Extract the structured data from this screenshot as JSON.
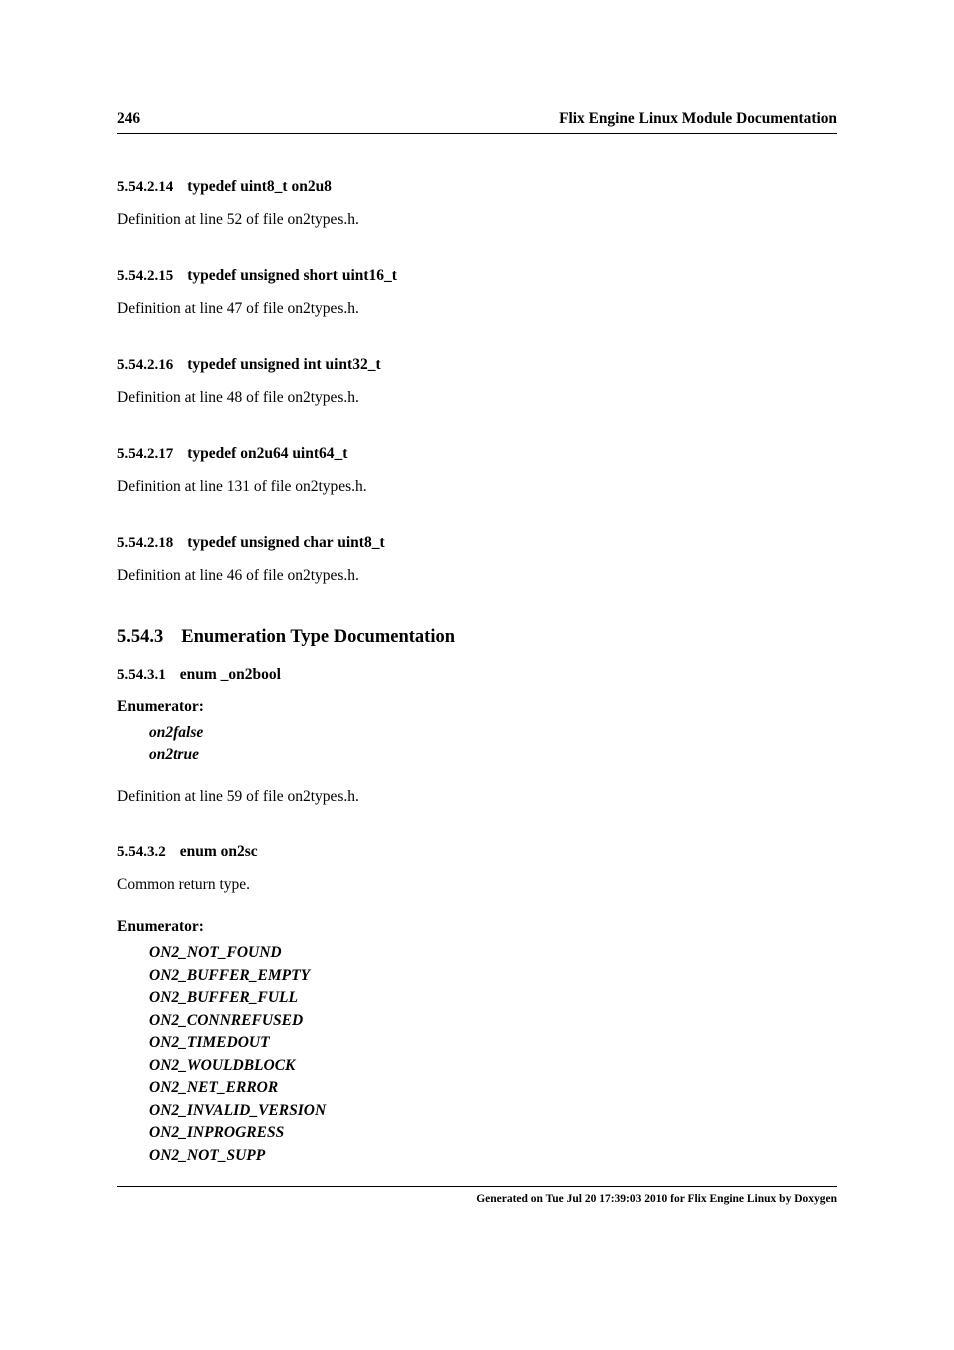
{
  "header": {
    "page_number": "246",
    "title": "Flix Engine Linux Module Documentation"
  },
  "sections": [
    {
      "num": "5.54.2.14",
      "title": "typedef uint8_t on2u8",
      "body": "Definition at line 52 of file on2types.h."
    },
    {
      "num": "5.54.2.15",
      "title": "typedef unsigned short uint16_t",
      "body": "Definition at line 47 of file on2types.h."
    },
    {
      "num": "5.54.2.16",
      "title": "typedef unsigned int uint32_t",
      "body": "Definition at line 48 of file on2types.h."
    },
    {
      "num": "5.54.2.17",
      "title": "typedef on2u64 uint64_t",
      "body": "Definition at line 131 of file on2types.h."
    },
    {
      "num": "5.54.2.18",
      "title": "typedef unsigned char uint8_t",
      "body": "Definition at line 46 of file on2types.h."
    }
  ],
  "enum_section": {
    "num": "5.54.3",
    "title": "Enumeration Type Documentation"
  },
  "enum1": {
    "num": "5.54.3.1",
    "title": "enum _on2bool",
    "label": "Enumerator:",
    "items": [
      "on2false",
      "on2true"
    ],
    "def": "Definition at line 59 of file on2types.h."
  },
  "enum2": {
    "num": "5.54.3.2",
    "title": "enum on2sc",
    "desc": "Common return type.",
    "label": "Enumerator:",
    "items": [
      "ON2_NOT_FOUND",
      "ON2_BUFFER_EMPTY",
      "ON2_BUFFER_FULL",
      "ON2_CONNREFUSED",
      "ON2_TIMEDOUT",
      "ON2_WOULDBLOCK",
      "ON2_NET_ERROR",
      "ON2_INVALID_VERSION",
      "ON2_INPROGRESS",
      "ON2_NOT_SUPP"
    ]
  },
  "footer": "Generated on Tue Jul 20 17:39:03 2010 for Flix Engine Linux by Doxygen"
}
